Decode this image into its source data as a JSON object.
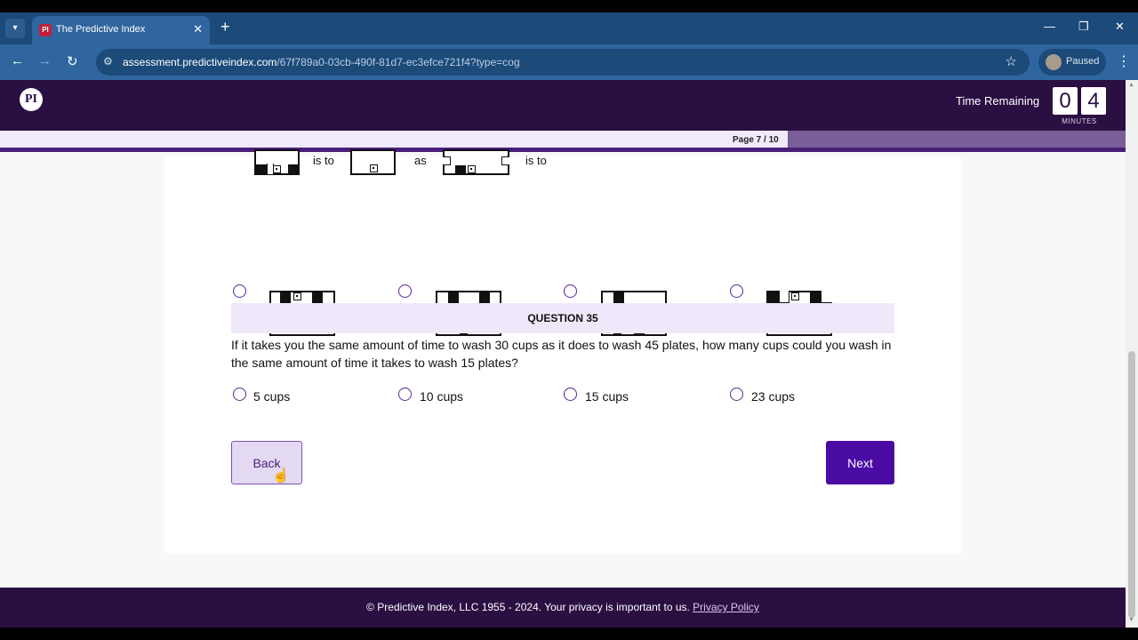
{
  "browser": {
    "tab_title": "The Predictive Index",
    "tab_favicon": "PI",
    "url_host": "assessment.predictiveindex.com",
    "url_path": "/67f789a0-03cb-490f-81d7-ec3efce721f4?type=cog",
    "profile_label": "Paused"
  },
  "header": {
    "logo": "PI",
    "time_remaining_label": "Time Remaining",
    "time_digits": [
      "0",
      "4"
    ],
    "time_unit": "MINUTES"
  },
  "progress": {
    "page_label": "Page 7 / 10",
    "fraction": 0.7
  },
  "puzzle": {
    "words": [
      "is to",
      "as",
      "is to"
    ]
  },
  "question": {
    "heading": "QUESTION 35",
    "text": "If it takes you the same amount of time to wash 30 cups as it does to wash 45 plates, how many cups could you wash in the same amount of time it takes to wash 15 plates?",
    "options": [
      "5 cups",
      "10 cups",
      "15 cups",
      "23 cups"
    ]
  },
  "buttons": {
    "back": "Back",
    "next": "Next"
  },
  "footer": {
    "copyright": "© Predictive Index, LLC 1955 - 2024. Your privacy is important to us.",
    "privacy_link": "Privacy Policy"
  },
  "colors": {
    "header_bg": "#2a0f42",
    "accent": "#4a0aa4",
    "radio": "#5b2597"
  }
}
